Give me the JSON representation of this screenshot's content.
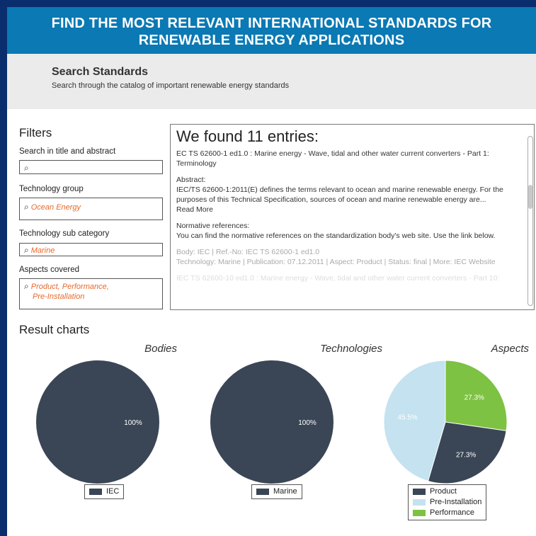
{
  "banner": {
    "line1": "FIND THE MOST RELEVANT INTERNATIONAL STANDARDS FOR",
    "line2": "RENEWABLE ENERGY APPLICATIONS"
  },
  "search": {
    "title": "Search Standards",
    "subtitle": "Search through the catalog of important renewable energy standards"
  },
  "filters": {
    "title": "Filters",
    "search_label": "Search in title and abstract",
    "search_value": "",
    "group_label": "Technology group",
    "group_value": "Ocean Energy",
    "sub_label": "Technology sub category",
    "sub_value": "Marine",
    "aspects_label": "Aspects covered",
    "aspects_value_1": "Product, Performance,",
    "aspects_value_2": "Pre-Installation"
  },
  "results": {
    "heading": "We found 11 entries:",
    "entry_title": "EC TS 62600-1 ed1.0 : Marine energy - Wave, tidal and other water current converters - Part 1: Terminology",
    "abstract_label": "Abstract:",
    "abstract_text": "IEC/TS 62600-1:2011(E) defines the terms relevant to ocean and marine renewable energy. For the purposes of this Technical Specification, sources of ocean and marine renewable energy are...",
    "read_more": "Read More",
    "normative_label": "Normative references:",
    "normative_text": "You can find the normative references on the standardization body's web site. Use the link below.",
    "meta_1": "Body: IEC | Ref.-No: IEC TS 62600-1 ed1.0",
    "meta_2": "Technology: Marine | Publication: 07.12.2011 | Aspect: Product | Status: final | More: IEC Website",
    "next_entry": "IEC TS 62600-10 ed1.0 : Marine energy - Wave, tidal and other water current converters - Part 10:"
  },
  "charts_title": "Result charts",
  "colors": {
    "dark": "#3a4656",
    "light": "#c4e2ef",
    "green": "#7dc242",
    "banner": "#0a79b4"
  },
  "chart_data": [
    {
      "type": "pie",
      "title": "Bodies",
      "labels": [
        "IEC"
      ],
      "values": [
        100
      ],
      "value_labels": [
        "100%"
      ],
      "colors": [
        "#3a4656"
      ],
      "legend": "bottom"
    },
    {
      "type": "pie",
      "title": "Technologies",
      "labels": [
        "Marine"
      ],
      "values": [
        100
      ],
      "value_labels": [
        "100%"
      ],
      "colors": [
        "#3a4656"
      ],
      "legend": "bottom"
    },
    {
      "type": "pie",
      "title": "Aspects",
      "labels": [
        "Product",
        "Pre-Installation",
        "Performance"
      ],
      "values": [
        27.3,
        45.5,
        27.3
      ],
      "value_labels": [
        "27.3%",
        "45.5%",
        "27.3%"
      ],
      "colors": [
        "#3a4656",
        "#c4e2ef",
        "#7dc242"
      ],
      "legend": "bottom"
    }
  ]
}
